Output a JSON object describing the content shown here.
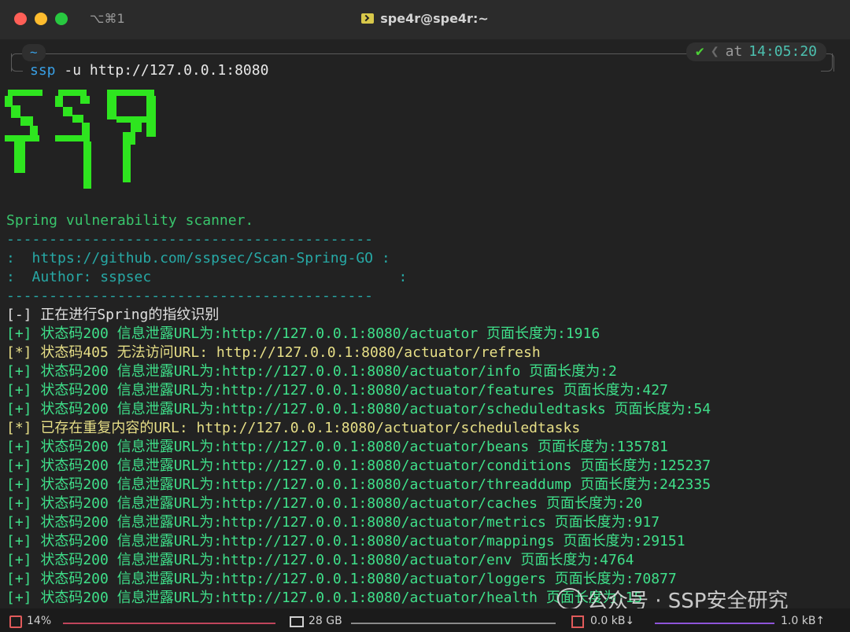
{
  "titlebar": {
    "shortcut": "⌥⌘1",
    "title": "spe4r@spe4r:~",
    "icon": "terminal-icon"
  },
  "prompt": {
    "cwd": "~",
    "check": "✔",
    "chevron": "❮",
    "at": "at",
    "time": "14:05:20",
    "command_exe": "ssp",
    "command_args": " -u http://127.0.0.1:8080"
  },
  "banner": {
    "logo": "SSP",
    "subtitle": "Spring vulnerability scanner.",
    "rule": "-------------------------------------------",
    "github": ":  https://github.com/sspsec/Scan-Spring-GO :",
    "author": ":  Author: sspsec                             :",
    "rule2": "-------------------------------------------"
  },
  "output": [
    {
      "text": "[-] 正在进行Spring的指纹识别",
      "style": "white"
    },
    {
      "text": "[+] 状态码200 信息泄露URL为:http://127.0.0.1:8080/actuator 页面长度为:1916",
      "style": "ok"
    },
    {
      "text": "[*] 状态码405 无法访问URL: http://127.0.0.1:8080/actuator/refresh",
      "style": "yellow"
    },
    {
      "text": "[+] 状态码200 信息泄露URL为:http://127.0.0.1:8080/actuator/info 页面长度为:2",
      "style": "ok"
    },
    {
      "text": "[+] 状态码200 信息泄露URL为:http://127.0.0.1:8080/actuator/features 页面长度为:427",
      "style": "ok"
    },
    {
      "text": "[+] 状态码200 信息泄露URL为:http://127.0.0.1:8080/actuator/scheduledtasks 页面长度为:54",
      "style": "ok"
    },
    {
      "text": "[*] 已存在重复内容的URL: http://127.0.0.1:8080/actuator/scheduledtasks",
      "style": "yellow"
    },
    {
      "text": "[+] 状态码200 信息泄露URL为:http://127.0.0.1:8080/actuator/beans 页面长度为:135781",
      "style": "ok"
    },
    {
      "text": "[+] 状态码200 信息泄露URL为:http://127.0.0.1:8080/actuator/conditions 页面长度为:125237",
      "style": "ok"
    },
    {
      "text": "[+] 状态码200 信息泄露URL为:http://127.0.0.1:8080/actuator/threaddump 页面长度为:242335",
      "style": "ok"
    },
    {
      "text": "[+] 状态码200 信息泄露URL为:http://127.0.0.1:8080/actuator/caches 页面长度为:20",
      "style": "ok"
    },
    {
      "text": "[+] 状态码200 信息泄露URL为:http://127.0.0.1:8080/actuator/metrics 页面长度为:917",
      "style": "ok"
    },
    {
      "text": "[+] 状态码200 信息泄露URL为:http://127.0.0.1:8080/actuator/mappings 页面长度为:29151",
      "style": "ok"
    },
    {
      "text": "[+] 状态码200 信息泄露URL为:http://127.0.0.1:8080/actuator/env 页面长度为:4764",
      "style": "ok"
    },
    {
      "text": "[+] 状态码200 信息泄露URL为:http://127.0.0.1:8080/actuator/loggers 页面长度为:70877",
      "style": "ok"
    },
    {
      "text": "[+] 状态码200 信息泄露URL为:http://127.0.0.1:8080/actuator/health 页面长度为:15",
      "style": "ok"
    }
  ],
  "statusbar": {
    "cpu": "14%",
    "memory": "28 GB",
    "net_down": "0.0 kB↓",
    "net_up": "1.0 kB↑"
  },
  "watermark": {
    "text": "公众号 · SSP安全研究"
  },
  "colors": {
    "background": "#222222",
    "banner_green": "#2ee51f",
    "success": "#3fe08a",
    "warning": "#e7df87",
    "teal": "#27a9a6",
    "prompt_blue": "#39a0e6"
  }
}
